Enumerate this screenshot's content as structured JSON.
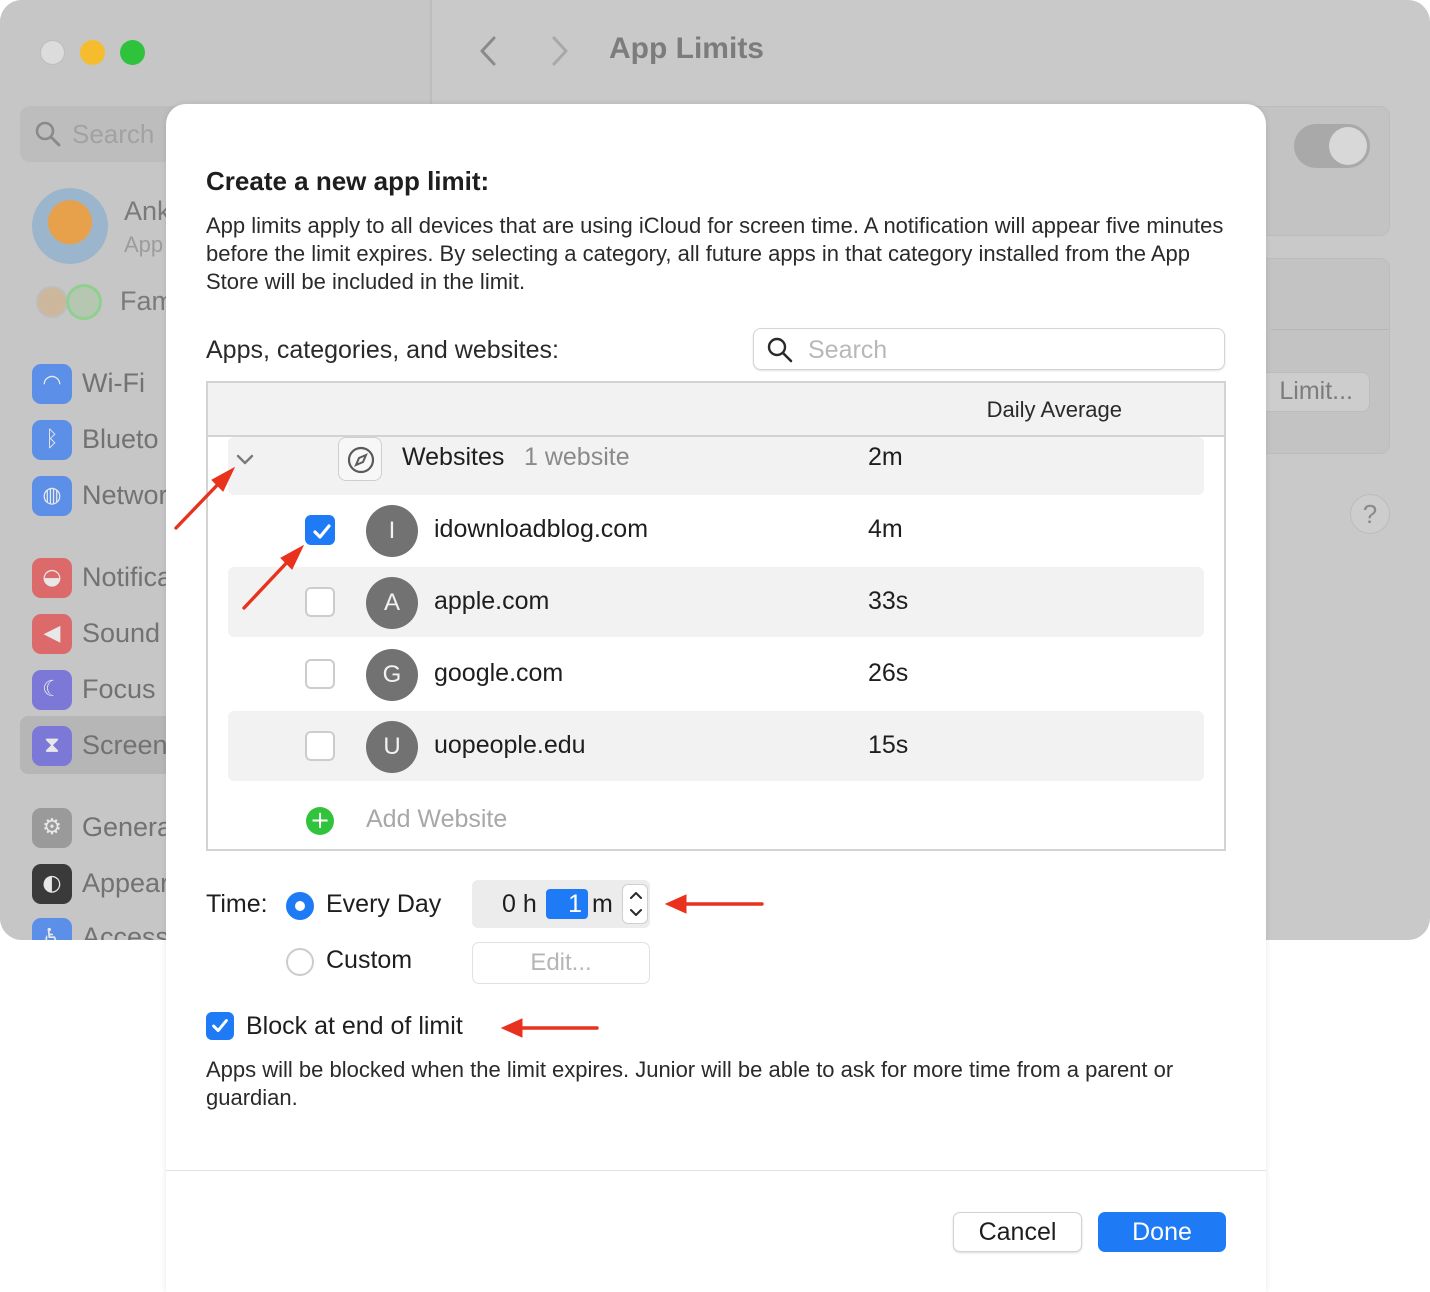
{
  "background": {
    "search_placeholder": "Search",
    "user_name": "Ank",
    "user_sub": "App",
    "family_label": "Fam",
    "sidebar_items": [
      {
        "label": "Wi-Fi",
        "icon": "wifi-icon",
        "color": "#3b82f6"
      },
      {
        "label": "Blueto",
        "icon": "bluetooth-icon",
        "color": "#3b82f6"
      },
      {
        "label": "Networ",
        "icon": "globe-icon",
        "color": "#3b82f6"
      },
      {
        "label": "Notifica",
        "icon": "bell-icon",
        "color": "#ef4444"
      },
      {
        "label": "Sound",
        "icon": "speaker-icon",
        "color": "#ef4444"
      },
      {
        "label": "Focus",
        "icon": "moon-icon",
        "color": "#6366f1"
      },
      {
        "label": "Screen",
        "icon": "hourglass-icon",
        "color": "#6366f1"
      },
      {
        "label": "Genera",
        "icon": "gear-icon",
        "color": "#8e8e93"
      },
      {
        "label": "Appear",
        "icon": "appearance-icon",
        "color": "#1c1c1e"
      },
      {
        "label": "Access",
        "icon": "accessibility-icon",
        "color": "#3b82f6"
      }
    ],
    "window_title": "App Limits",
    "limit_button": "Limit...",
    "help_label": "?"
  },
  "sheet": {
    "title": "Create a new app limit:",
    "description": "App limits apply to all devices that are using iCloud for screen time. A notification will appear five minutes before the limit expires. By selecting a category, all future apps in that category installed from the App Store will be included in the limit.",
    "apps_label": "Apps, categories, and websites:",
    "search_placeholder": "Search",
    "table": {
      "column_header": "Daily Average",
      "group": {
        "name": "Websites",
        "count": "1 website",
        "time": "2m",
        "expanded": true
      },
      "rows": [
        {
          "letter": "I",
          "domain": "idownloadblog.com",
          "time": "4m",
          "checked": true
        },
        {
          "letter": "A",
          "domain": "apple.com",
          "time": "33s",
          "checked": false
        },
        {
          "letter": "G",
          "domain": "google.com",
          "time": "26s",
          "checked": false
        },
        {
          "letter": "U",
          "domain": "uopeople.edu",
          "time": "15s",
          "checked": false
        }
      ],
      "add_label": "Add Website"
    },
    "time": {
      "label": "Time:",
      "option_every_day": "Every Day",
      "option_custom": "Custom",
      "selected": "Every Day",
      "hours_value": "0",
      "hours_unit": "h",
      "minutes_value": "1",
      "minutes_unit": "m",
      "edit_label": "Edit..."
    },
    "block": {
      "label": "Block at end of limit",
      "checked": true,
      "description": "Apps will be blocked when the limit expires. Junior will be able to ask for more time from a parent or guardian."
    },
    "buttons": {
      "cancel": "Cancel",
      "done": "Done"
    }
  },
  "colors": {
    "accent": "#1e7bf5",
    "annotation": "#e8321e",
    "add_green": "#32c33c"
  }
}
